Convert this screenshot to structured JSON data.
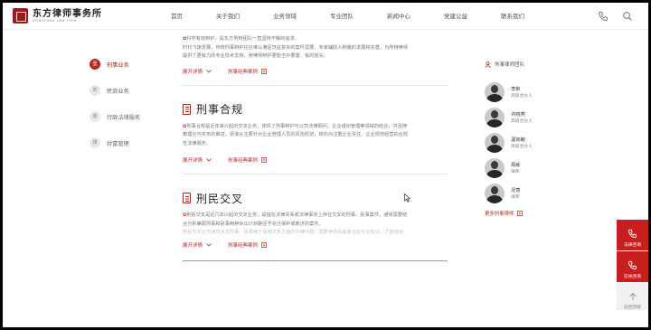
{
  "header": {
    "logo_cn": "东方律师事务所",
    "logo_en": "DONGFANG LAW FIRM",
    "nav": [
      "首页",
      "关于我们",
      "业务领域",
      "专业团队",
      "新闻中心",
      "党建公益",
      "联系我们"
    ]
  },
  "sidebar": {
    "items": [
      {
        "num": "壹",
        "label": "刑事业务"
      },
      {
        "num": "贰",
        "label": "民商业务"
      },
      {
        "num": "叁",
        "label": "行政法律服务"
      },
      {
        "num": "肆",
        "label": "财富管理"
      }
    ]
  },
  "content": {
    "intro": {
      "line1": "科学有效辩护，是东方刑辩团队一直坚持不懈的追求。",
      "line2": "时代飞速发展，传统刑事辩护往往难以满足日益复杂的案件需要。专家辅助人制度的发展和完善，为刑辩律师",
      "line3": "提供了更有力的专业技术支持，使律师辩护更能击中要害、有的放矢。",
      "expand": "展开详情",
      "cases": "刑事经典案例"
    },
    "sections": [
      {
        "title": "刑事合规",
        "l1": "刑事合规是近年来兴起的交叉业务，体现了刑事辩护与公司法律顾问、企业组织管理等领域的结合，并且随",
        "l2": "着理论与实务的推进，逐渐从主要针对企业管理人员的风险防范，转向为注重企业责任、企业规范经营的合规",
        "l3": "性法律服务。",
        "expand": "展开详情",
        "cases": "刑事经典案例"
      },
      {
        "title": "刑民交叉",
        "l1": "刑民交叉是近几年兴起的交叉业务，是指在法律关系或法律事实上存在交叉的刑事、民事案件。通常需要结",
        "l2": "合分别兼顾刑事和民事两种诉讼计划路径予充分保护或救济的案件。",
        "l3": "刑民交叉业务通常涉及刑事、民事两个领域中多方面的法律问题，需要律师具备复合型专业知识，才能有效",
        "expand": "展开详情",
        "cases": "刑事经典案例"
      }
    ]
  },
  "team": {
    "title": "刑事律师团队",
    "members": [
      {
        "name": "李彬",
        "role": "高级合伙人"
      },
      {
        "name": "许晓燕",
        "role": "高级合伙人"
      },
      {
        "name": "温如敏",
        "role": "高级合伙人"
      },
      {
        "name": "周栋",
        "role": "律师"
      },
      {
        "name": "况意",
        "role": "律师"
      }
    ],
    "more": "更多刑事律师"
  },
  "float": {
    "consult": "法律咨询",
    "online": "在线咨询",
    "top": "返回顶部"
  },
  "colors": {
    "accent": "#b52a20",
    "float_red": "#c81e1e"
  }
}
